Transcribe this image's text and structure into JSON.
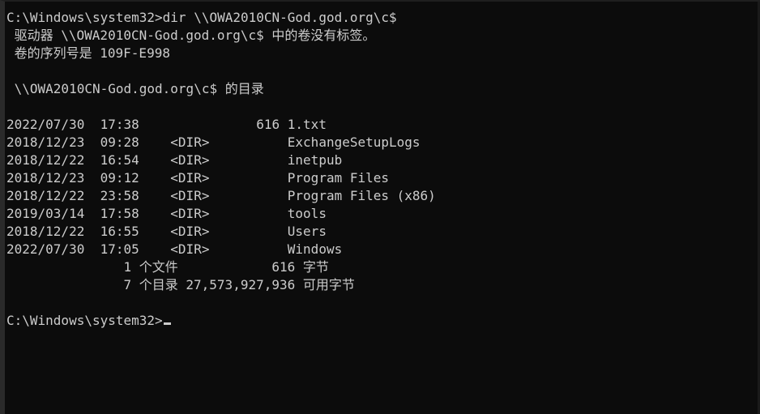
{
  "console": {
    "lines": [
      "C:\\Windows\\system32>dir \\\\OWA2010CN-God.god.org\\c$",
      " 驱动器 \\\\OWA2010CN-God.god.org\\c$ 中的卷没有标签。",
      " 卷的序列号是 109F-E998",
      "",
      " \\\\OWA2010CN-God.god.org\\c$ 的目录",
      "",
      "2022/07/30  17:38               616 1.txt",
      "2018/12/23  09:28    <DIR>          ExchangeSetupLogs",
      "2018/12/22  16:54    <DIR>          inetpub",
      "2018/12/23  09:12    <DIR>          Program Files",
      "2018/12/22  23:58    <DIR>          Program Files (x86)",
      "2019/03/14  17:58    <DIR>          tools",
      "2018/12/22  16:55    <DIR>          Users",
      "2022/07/30  17:05    <DIR>          Windows",
      "               1 个文件            616 字节",
      "               7 个目录 27,573,927,936 可用字节",
      "",
      "C:\\Windows\\system32>"
    ]
  }
}
